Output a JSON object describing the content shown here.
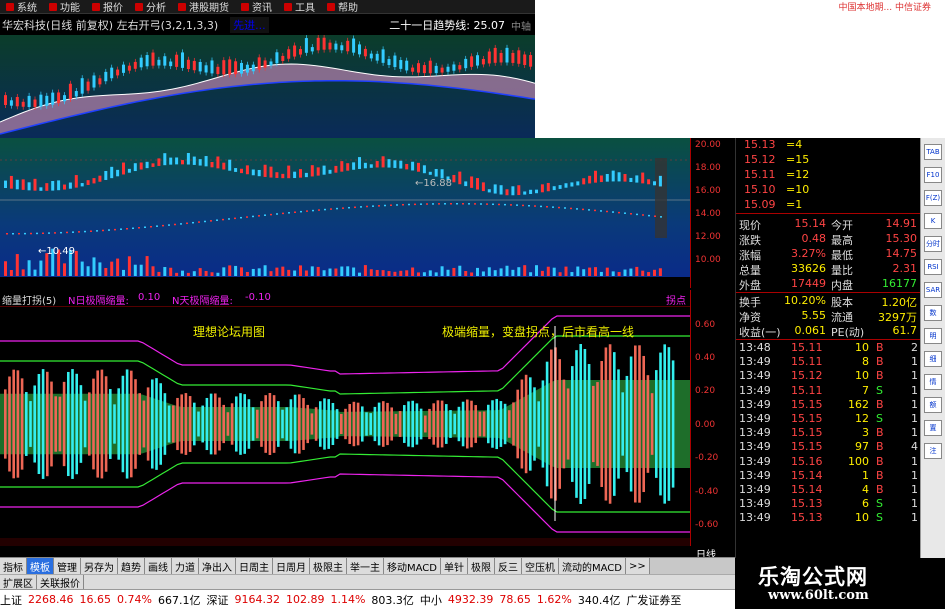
{
  "menu": {
    "items": [
      "系统",
      "功能",
      "报价",
      "分析",
      "港股期货",
      "资讯",
      "工具",
      "帮助"
    ]
  },
  "brand_top": "中国本地期... 中信证券",
  "title": {
    "stock": "华宏科技(日线 前复权)",
    "indicator": "左右开弓(3,2,1,3,3)",
    "alert": "先进...",
    "trend": "二十一日趋势线: 25.07",
    "right": "中轴"
  },
  "price_labels": {
    "mark1": "←16.88",
    "mark2": "←10.49"
  },
  "price_axis": [
    "20.00",
    "18.00",
    "16.00",
    "14.00",
    "12.00",
    "10.00"
  ],
  "osc": {
    "title": "缩量打拐(5)",
    "n1_label": "N日极隔缩量:",
    "n1_value": "0.10",
    "n2_label": "N天极隔缩量:",
    "n2_value": "-0.10",
    "tag": "拐点",
    "annot1": "理想论坛用图",
    "annot2": "极端缩量，变盘拐点，后市看高一线"
  },
  "osc_axis": [
    "0.60",
    "0.40",
    "0.20",
    "0.00",
    "-0.20",
    "-0.40",
    "-0.60"
  ],
  "orderbook": [
    {
      "price": "15.13",
      "vol": "4"
    },
    {
      "price": "15.12",
      "vol": "15"
    },
    {
      "price": "15.11",
      "vol": "12"
    },
    {
      "price": "15.10",
      "vol": "10"
    },
    {
      "price": "15.09",
      "vol": "1"
    }
  ],
  "quote": [
    {
      "l1": "现价",
      "v1": "15.14",
      "l2": "今开",
      "v2": "14.91"
    },
    {
      "l1": "涨跌",
      "v1": "0.48",
      "l2": "最高",
      "v2": "15.30"
    },
    {
      "l1": "涨幅",
      "v1": "3.27%",
      "l2": "最低",
      "v2": "14.75"
    },
    {
      "l1": "总量",
      "v1": "33626",
      "l2": "量比",
      "v2": "2.31"
    },
    {
      "l1": "外盘",
      "v1": "17449",
      "l2": "内盘",
      "v2": "16177"
    },
    {
      "l1": "换手",
      "v1": "10.20%",
      "l2": "股本",
      "v2": "1.20亿"
    },
    {
      "l1": "净资",
      "v1": "5.55",
      "l2": "流通",
      "v2": "3297万"
    },
    {
      "l1": "收益(一)",
      "v1": "0.061",
      "l2": "PE(动)",
      "v2": "61.7"
    }
  ],
  "ticks": [
    {
      "t": "13:48",
      "p": "15.11",
      "v": "10",
      "s": "B",
      "n": "2"
    },
    {
      "t": "13:49",
      "p": "15.11",
      "v": "8",
      "s": "B",
      "n": "1"
    },
    {
      "t": "13:49",
      "p": "15.12",
      "v": "10",
      "s": "B",
      "n": "1"
    },
    {
      "t": "13:49",
      "p": "15.11",
      "v": "7",
      "s": "S",
      "n": "1"
    },
    {
      "t": "13:49",
      "p": "15.15",
      "v": "162",
      "s": "B",
      "n": "1"
    },
    {
      "t": "13:49",
      "p": "15.15",
      "v": "12",
      "s": "S",
      "n": "1"
    },
    {
      "t": "13:49",
      "p": "15.15",
      "v": "3",
      "s": "B",
      "n": "1"
    },
    {
      "t": "13:49",
      "p": "15.15",
      "v": "97",
      "s": "B",
      "n": "4"
    },
    {
      "t": "13:49",
      "p": "15.16",
      "v": "100",
      "s": "B",
      "n": "1"
    },
    {
      "t": "13:49",
      "p": "15.14",
      "v": "1",
      "s": "B",
      "n": "1"
    },
    {
      "t": "13:49",
      "p": "15.14",
      "v": "4",
      "s": "B",
      "n": "1"
    },
    {
      "t": "13:49",
      "p": "15.13",
      "v": "6",
      "s": "S",
      "n": "1"
    },
    {
      "t": "13:49",
      "p": "15.13",
      "v": "10",
      "s": "S",
      "n": "1"
    }
  ],
  "icons": [
    "TAB",
    "F10",
    "F(Z)",
    "K",
    "分时",
    "RSI",
    "SAR",
    "数",
    "明",
    "细",
    "情",
    "额",
    "置",
    "注"
  ],
  "tabs": [
    "指标",
    "模板",
    "管理",
    "另存为",
    "趋势",
    "画线",
    "力道",
    "净出入",
    "日周主",
    "日周月",
    "极限主",
    "举一主",
    "移动MACD",
    "单针",
    "极限",
    "反三",
    "空压机",
    "流动的MACD",
    ">>"
  ],
  "tabs2": [
    "扩展区",
    "关联报价"
  ],
  "rink": "日线",
  "status": [
    {
      "text": "上证",
      "c": "#000"
    },
    {
      "text": "2268.46",
      "c": "#d00"
    },
    {
      "text": "16.65",
      "c": "#d00"
    },
    {
      "text": "0.74%",
      "c": "#d00"
    },
    {
      "text": "667.1亿",
      "c": "#000"
    },
    {
      "text": "深证",
      "c": "#000"
    },
    {
      "text": "9164.32",
      "c": "#d00"
    },
    {
      "text": "102.89",
      "c": "#d00"
    },
    {
      "text": "1.14%",
      "c": "#d00"
    },
    {
      "text": "803.3亿",
      "c": "#000"
    },
    {
      "text": "中小",
      "c": "#000"
    },
    {
      "text": "4932.39",
      "c": "#d00"
    },
    {
      "text": "78.65",
      "c": "#d00"
    },
    {
      "text": "1.62%",
      "c": "#d00"
    },
    {
      "text": "340.4亿",
      "c": "#000"
    },
    {
      "text": "广发证券至",
      "c": "#000"
    }
  ],
  "watermark": {
    "cn": "乐淘公式网",
    "url": "www.60lt.com"
  },
  "colors": {
    "up": "#ff3333",
    "down": "#33ccff",
    "ma": "#ffffff",
    "band": "#1e6e2a",
    "magenta": "#ee22ee",
    "lime": "#33ee33"
  }
}
